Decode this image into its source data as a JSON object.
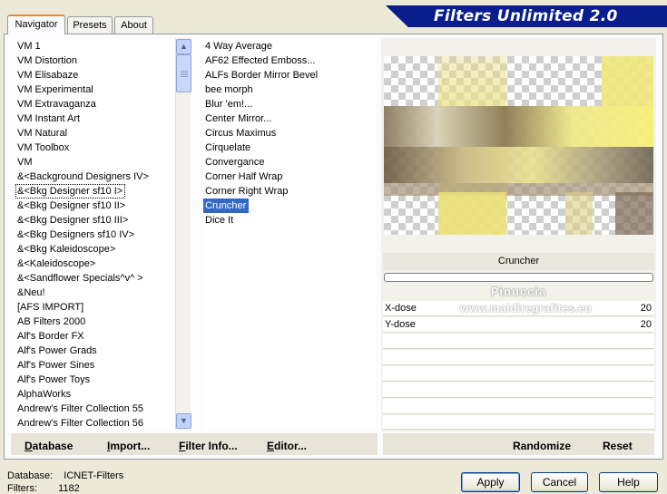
{
  "tabs": [
    {
      "label": "Navigator",
      "active": true
    },
    {
      "label": "Presets",
      "active": false
    },
    {
      "label": "About",
      "active": false
    }
  ],
  "banner_title": "Filters Unlimited 2.0",
  "categories": [
    "VM 1",
    "VM Distortion",
    "VM Elisabaze",
    "VM Experimental",
    "VM Extravaganza",
    "VM Instant Art",
    "VM Natural",
    "VM Toolbox",
    "VM",
    "&<Background Designers IV>",
    "&<Bkg Designer sf10 I>",
    "&<Bkg Designer sf10 II>",
    "&<Bkg Designer sf10 III>",
    "&<Bkg Designers sf10 IV>",
    "&<Bkg Kaleidoscope>",
    "&<Kaleidoscope>",
    "&<Sandflower Specials^v^ >",
    "&Neu!",
    "[AFS IMPORT]",
    "AB Filters 2000",
    "Alf's Border FX",
    "Alf's Power Grads",
    "Alf's Power Sines",
    "Alf's Power Toys",
    "AlphaWorks",
    "Andrew's Filter Collection 55",
    "Andrew's Filter Collection 56"
  ],
  "selected_category": "&<Bkg Designer sf10 I>",
  "filters": [
    "4 Way Average",
    "AF62 Effected Emboss...",
    "ALFs Border Mirror Bevel",
    "bee morph",
    "Blur 'em!...",
    "Center Mirror...",
    "Circus Maximus",
    "Cirquelate",
    "Convergance",
    "Corner Half Wrap",
    "Corner Right Wrap",
    "Cruncher",
    "Dice It"
  ],
  "selected_filter": "Cruncher",
  "preview_filter_name": "Cruncher",
  "author_mark": "Pinuccia",
  "watermark": "www.maldiregrafites.eu",
  "params": [
    {
      "label": "X-dose",
      "value": "20"
    },
    {
      "label": "Y-dose",
      "value": "20"
    }
  ],
  "left_buttons": {
    "database": "Database",
    "import": "Import...",
    "filter_info": "Filter Info...",
    "editor": "Editor..."
  },
  "right_buttons": {
    "randomize": "Randomize",
    "reset": "Reset"
  },
  "status": {
    "database_label": "Database:",
    "database_value": "ICNET-Filters",
    "filters_label": "Filters:",
    "filters_value": "1182"
  },
  "dialog_buttons": {
    "apply": "Apply",
    "cancel": "Cancel",
    "help": "Help"
  },
  "colors": {
    "banner": "#0a1d8c",
    "selection": "#316ac5",
    "preview_yellow": "#f1e67a",
    "preview_brown": "#6b5840"
  }
}
